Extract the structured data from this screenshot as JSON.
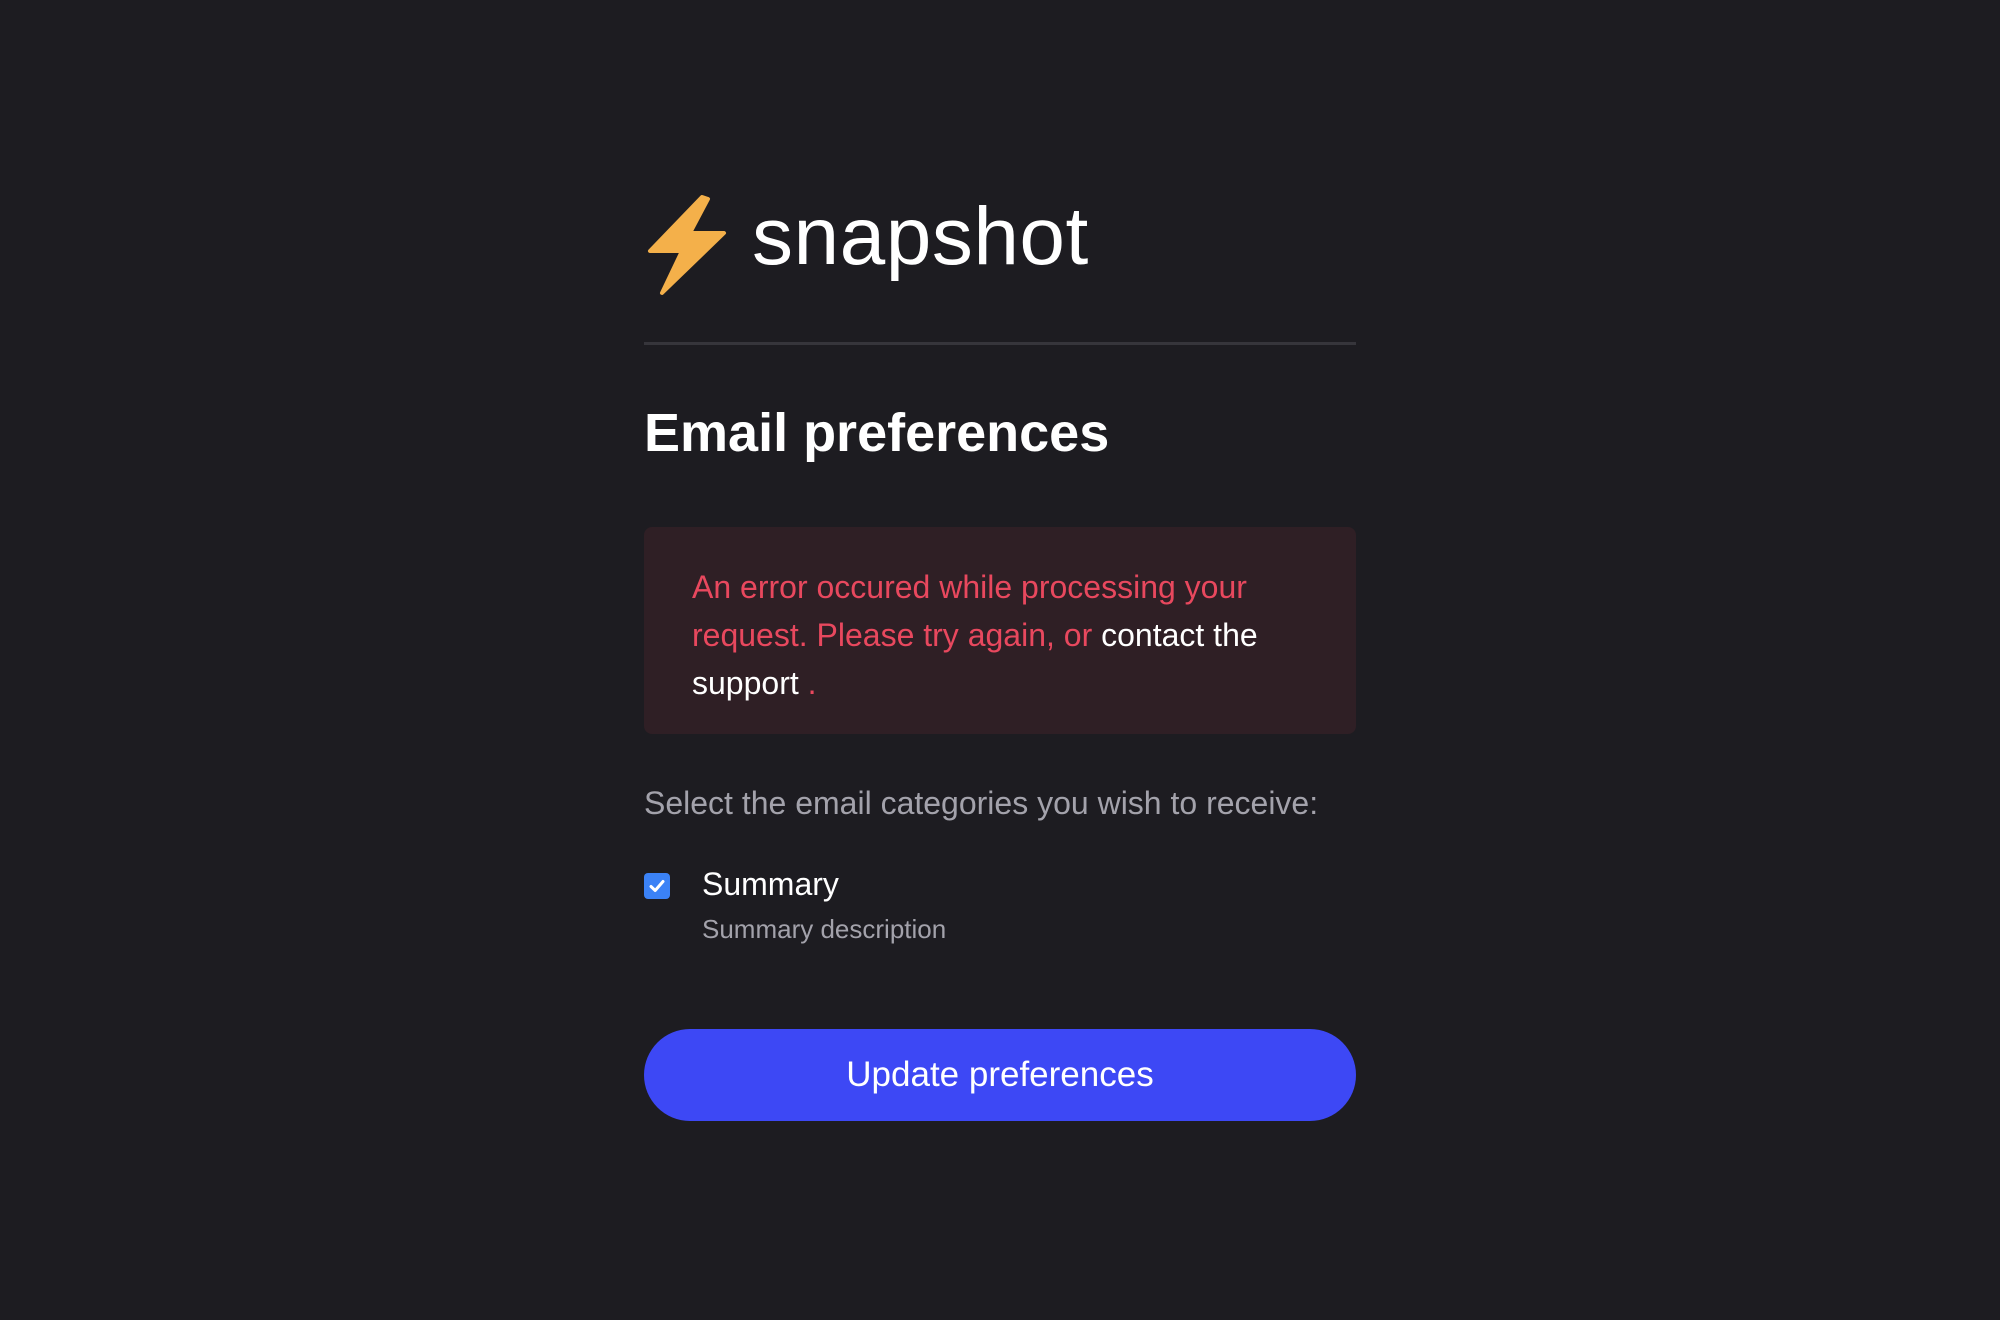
{
  "brand": {
    "name": "snapshot",
    "icon": "lightning-bolt-icon",
    "icon_color": "#f4b04a"
  },
  "page": {
    "title": "Email preferences"
  },
  "error": {
    "message_part1": "An error occured while processing your request. Please try again, or ",
    "link_text": "contact the support",
    "message_part2": " .",
    "text_color": "#e8485e",
    "background_color": "#2f1f25"
  },
  "preferences": {
    "instructions": "Select the email categories you wish to receive:",
    "items": [
      {
        "label": "Summary",
        "description": "Summary description",
        "checked": true
      }
    ]
  },
  "actions": {
    "submit_label": "Update preferences",
    "button_color": "#3d48f5"
  }
}
